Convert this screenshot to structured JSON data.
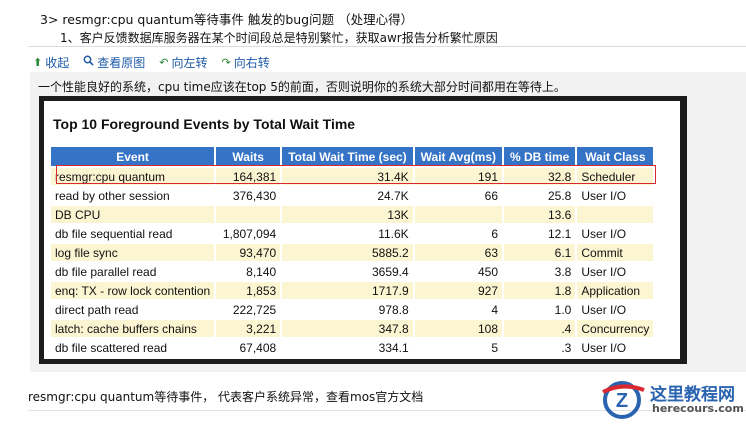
{
  "article": {
    "heading": "3>   resmgr:cpu quantum等待事件 触发的bug问题   （处理心得）",
    "subline": "1、客户反馈数据库服务器在某个时间段总是特别繁忙，获取awr报告分析繁忙原因"
  },
  "toolbar": {
    "collapse": "收起",
    "view_original": "查看原图",
    "rotate_left": "向左转",
    "rotate_right": "向右转",
    "icons": {
      "collapse": "arrow-up-icon",
      "view_original": "magnify-icon",
      "rotate_left": "rotate-left-icon",
      "rotate_right": "rotate-right-icon"
    }
  },
  "caption": "一个性能良好的系统，cpu time应该在top 5的前面，否则说明你的系统大部分时间都用在等待上。",
  "report": {
    "title": "Top 10 Foreground Events by Total Wait Time",
    "columns": [
      "Event",
      "Waits",
      "Total Wait Time (sec)",
      "Wait Avg(ms)",
      "% DB time",
      "Wait Class"
    ],
    "rows": [
      [
        "resmgr:cpu quantum",
        "164,381",
        "31.4K",
        "191",
        "32.8",
        "Scheduler"
      ],
      [
        "read by other session",
        "376,430",
        "24.7K",
        "66",
        "25.8",
        "User I/O"
      ],
      [
        "DB CPU",
        "",
        "13K",
        "",
        "13.6",
        ""
      ],
      [
        "db file sequential read",
        "1,807,094",
        "11.6K",
        "6",
        "12.1",
        "User I/O"
      ],
      [
        "log file sync",
        "93,470",
        "5885.2",
        "63",
        "6.1",
        "Commit"
      ],
      [
        "db file parallel read",
        "8,140",
        "3659.4",
        "450",
        "3.8",
        "User I/O"
      ],
      [
        "enq: TX - row lock contention",
        "1,853",
        "1717.9",
        "927",
        "1.8",
        "Application"
      ],
      [
        "direct path read",
        "222,725",
        "978.8",
        "4",
        "1.0",
        "User I/O"
      ],
      [
        "latch: cache buffers chains",
        "3,221",
        "347.8",
        "108",
        ".4",
        "Concurrency"
      ],
      [
        "db file scattered read",
        "67,408",
        "334.1",
        "5",
        ".3",
        "User I/O"
      ]
    ],
    "colors": {
      "header": "#3573c7",
      "odd_row": "#fcf5d1",
      "highlight": "#d9282f"
    }
  },
  "footer_text": "resmgr:cpu quantum等待事件， 代表客户系统异常，查看mos官方文档",
  "watermark": {
    "title": "这里教程网",
    "url": "herecours.com",
    "logo_letter": "Z"
  }
}
